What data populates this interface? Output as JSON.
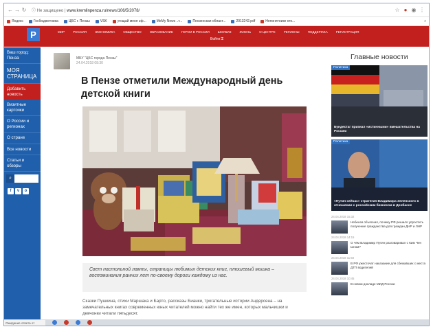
{
  "browser": {
    "url_prefix": "Не защищено",
    "url": "www.kremlinpenza.ru/news/106/5/2078/",
    "bookmarks": [
      "Яндекс",
      "Госбюджетника",
      "ЦБС г. Пензы",
      "VSK",
      "угощай меня эф...",
      "MeMy News ..т...",
      "Пензенская област...",
      "2013242.pdf",
      "Непонятнике кто..."
    ],
    "bookmarks_more": "»"
  },
  "site": {
    "logo": "P",
    "nav": [
      "Мир",
      "Россия",
      "Экономика",
      "Общество",
      "Образование",
      "Герои в России",
      "Шоубиз",
      "Жизнь",
      "О центре",
      "Регионы",
      "Поддержка",
      "Регистрация"
    ],
    "nav_row2": "Войти"
  },
  "sidebar": {
    "items": [
      {
        "label": "Ваш город: Пенза"
      },
      {
        "label": "МОЯ СТРАНИЦА",
        "big": true
      },
      {
        "label": "Добавить новость",
        "active": true
      },
      {
        "label": "Визитные карточки"
      },
      {
        "label": "О России и регионах"
      },
      {
        "label": "О стране"
      },
      {
        "label": "Все новости"
      },
      {
        "label": "Статьи и обзоры"
      }
    ],
    "search_icon": "⌕",
    "social": [
      "f",
      "v",
      "o"
    ]
  },
  "article": {
    "author": "МБУ \"ЦБС города Пензы\"",
    "date": "24.04.2018 08:30",
    "headline": "В Пензе отметили Международный день детской книги",
    "caption": "Свет настольной лампы, страницы любимых детских книг, плюшевый мишка – воспоминания ранних лет по-своему дороги каждому из нас.",
    "body": "Сказки Пушкина, стихи Маршака и Барто, рассказы Бианки, трогательные истории Андерсена – на замечательных книгах современных юных читателей можно найти тех же имен, которых мальчишки и девчонки читали пятьдесят."
  },
  "rightcol": {
    "title": "Главные новости",
    "cards": [
      {
        "label": "Политика",
        "text": "Бундестаг признал «истинными» вмешательства на Россию"
      },
      {
        "label": "Политика",
        "text": "«Путин сейчас» стратегия Владимира Зеленского в отношении с российским бизнесом в Донбассе"
      }
    ],
    "minis": [
      {
        "date": "24.04.2018 15:32",
        "text": "Небензя объяснил, почему РФ решило упростить получение гражданства для граждан ДНР и ЛНР"
      },
      {
        "date": "24.04.2018 14:15",
        "text": "О чём Владимир Путин разговаривал с Ким Чен Ыном?"
      },
      {
        "date": "24.04.2018 11:50",
        "text": "В РФ ужесточат наказание для сбежавших с места ДТП водителей"
      },
      {
        "date": "24.04.2018 10:45",
        "text": "В новом докладе МИД России"
      }
    ]
  },
  "status": {
    "text": "Ожидание ответа от kremlinpenza..."
  },
  "colors": {
    "brand_red": "#c21f1f",
    "sidebar_blue": "#1f5fab",
    "label_blue": "#2e6fbf"
  }
}
